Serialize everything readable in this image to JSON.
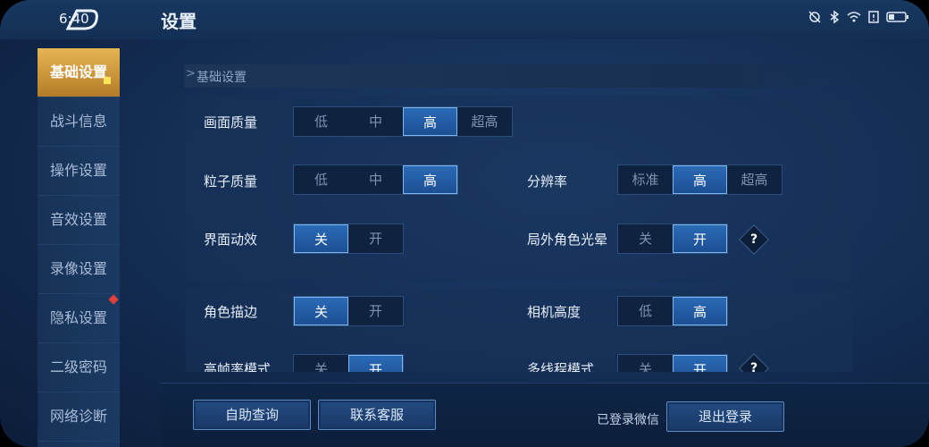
{
  "status": {
    "time": "6:40"
  },
  "header": {
    "title": "设置"
  },
  "sidebar": {
    "items": [
      {
        "label": "基础设置"
      },
      {
        "label": "战斗信息"
      },
      {
        "label": "操作设置"
      },
      {
        "label": "音效设置"
      },
      {
        "label": "录像设置"
      },
      {
        "label": "隐私设置"
      },
      {
        "label": "二级密码"
      },
      {
        "label": "网络诊断"
      }
    ]
  },
  "section": {
    "title": "基础设置"
  },
  "settings": {
    "quality": {
      "label": "画面质量",
      "options": [
        "低",
        "中",
        "高",
        "超高"
      ],
      "selected": "高"
    },
    "particle": {
      "label": "粒子质量",
      "options": [
        "低",
        "中",
        "高"
      ],
      "selected": "高"
    },
    "resolution": {
      "label": "分辨率",
      "options": [
        "标准",
        "高",
        "超高"
      ],
      "selected": "高"
    },
    "ui_effect": {
      "label": "界面动效",
      "options": [
        "关",
        "开"
      ],
      "selected": "关"
    },
    "outer_glow": {
      "label": "局外角色光晕",
      "options": [
        "关",
        "开"
      ],
      "selected": "开",
      "help": "?"
    },
    "outline": {
      "label": "角色描边",
      "options": [
        "关",
        "开"
      ],
      "selected": "关"
    },
    "camera": {
      "label": "相机高度",
      "options": [
        "低",
        "高"
      ],
      "selected": "高"
    },
    "hfr": {
      "label": "高帧率模式",
      "options": [
        "关",
        "开"
      ],
      "selected": "开"
    },
    "multithread": {
      "label": "多线程模式",
      "options": [
        "关",
        "开"
      ],
      "selected": "开",
      "help": "?"
    }
  },
  "footer": {
    "self_help": "自助查询",
    "contact": "联系客服",
    "wechat_status": "已登录微信",
    "logout": "退出登录"
  },
  "colors": {
    "accent_gold": "#e6b552",
    "selected_blue": "#2a6ab6",
    "badge_red": "#e2403c"
  }
}
